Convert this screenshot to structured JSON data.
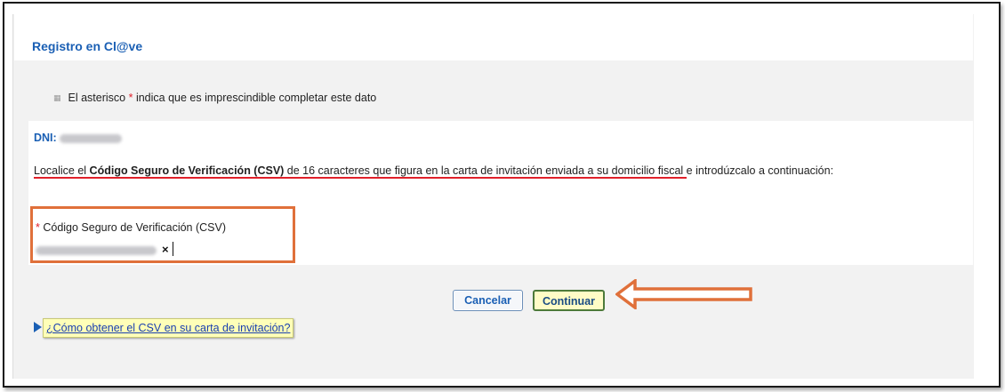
{
  "title": "Registro en Cl@ve",
  "hint": {
    "prefix": "El asterisco ",
    "star": "*",
    "suffix": " indica que es imprescindible completar este dato"
  },
  "dni": {
    "label": "DNI:"
  },
  "instructions": {
    "part1": "Localice el ",
    "bold": "Código Seguro de Verificación (CSV)",
    "part2": " de 16 caracteres que figura en la carta de invitación enviada a su domicilio fiscal e introdúzcalo a continuación:"
  },
  "csv_field": {
    "star": "*",
    "label": " Código Seguro de Verificación (CSV)",
    "clear_glyph": "×"
  },
  "buttons": {
    "cancel": "Cancelar",
    "continue": "Continuar"
  },
  "help_link": "¿Cómo obtener el CSV en su carta de invitación?",
  "colors": {
    "accent": "#1a5fb4",
    "highlight": "#e0703a",
    "required": "#e0202a",
    "link_bg": "#ffffb8"
  },
  "icons": {
    "bullet": "small-square-bullet-icon",
    "clear": "clear-x-icon",
    "arrow": "left-arrow-icon",
    "expand": "triangle-right-icon"
  }
}
